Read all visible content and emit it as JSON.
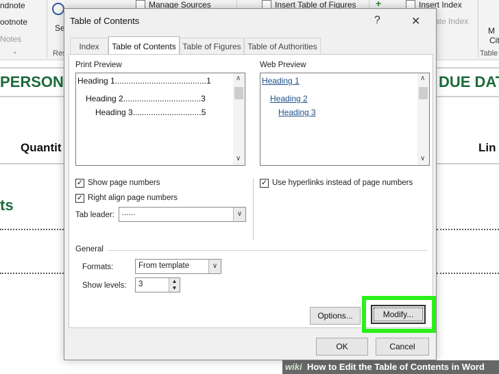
{
  "ribbon": {
    "endnote": "ndnote",
    "footnote": "ootnote",
    "notes": "Notes",
    "se": "Se",
    "res": "Res",
    "manage_sources": "Manage Sources",
    "insert_table_of_figures": "Insert Table of Figures",
    "insert_index": "Insert Index",
    "update_index": "ate Index",
    "m": "M",
    "cit": "Cit",
    "table_of": "Table o"
  },
  "document": {
    "person": "PERSON",
    "due_date": "DUE DAT",
    "quantity": "Quantit",
    "lin": "Lin",
    "ts": "ts"
  },
  "dialog": {
    "title": "Table of Contents",
    "help": "?",
    "close": "✕",
    "tabs": [
      "Index",
      "Table of Contents",
      "Table of Figures",
      "Table of Authorities"
    ],
    "active_tab": 1,
    "print_preview": {
      "label": "Print Preview",
      "lines": [
        {
          "text": "Heading 1........................................1"
        },
        {
          "text": "Heading 2..................................3"
        },
        {
          "text": "Heading 3..............................5"
        }
      ]
    },
    "web_preview": {
      "label": "Web Preview",
      "links": [
        "Heading 1",
        "Heading 2",
        "Heading 3"
      ]
    },
    "show_page_numbers": {
      "label": "Show page numbers",
      "checked": true
    },
    "right_align": {
      "label": "Right align page numbers",
      "checked": true
    },
    "use_hyperlinks": {
      "label": "Use hyperlinks instead of page numbers",
      "checked": true
    },
    "tab_leader": {
      "label": "Tab leader:",
      "value": "......"
    },
    "general": {
      "label": "General",
      "formats_label": "Formats:",
      "formats_value": "From template",
      "show_levels_label": "Show levels:",
      "show_levels_value": "3"
    },
    "options_button": "Options...",
    "modify_button": "Modify...",
    "ok_button": "OK",
    "cancel_button": "Cancel"
  },
  "watermark": {
    "wiki": "wiki",
    "text": "How to Edit the Table of Contents in Word"
  },
  "colors": {
    "highlight": "#2df01a",
    "doc_green": "#1d6b3a",
    "link_blue": "#1f4e8a"
  }
}
